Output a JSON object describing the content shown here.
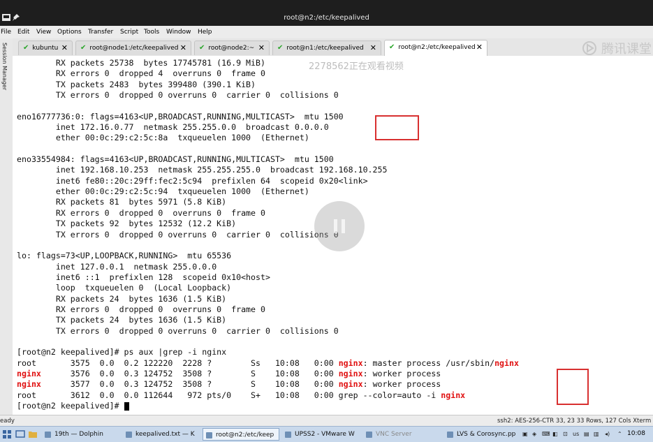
{
  "window": {
    "title": "root@n2:/etc/keepalived"
  },
  "menu": [
    "File",
    "Edit",
    "View",
    "Options",
    "Transfer",
    "Script",
    "Tools",
    "Window",
    "Help"
  ],
  "sidebar": {
    "label": "Session Manager"
  },
  "tabs": [
    {
      "label": "kubuntu",
      "active": false
    },
    {
      "label": "root@node1:/etc/keepalived",
      "active": false
    },
    {
      "label": "root@node2:~",
      "active": false
    },
    {
      "label": "root@n1:/etc/keepalived",
      "active": false
    },
    {
      "label": "root@n2:/etc/keepalived",
      "active": true
    }
  ],
  "brand": "腾讯课堂",
  "watermark": "2278562正在观看视频",
  "terminal": {
    "lines": [
      [
        {
          "t": "        RX packets 25738  bytes 17745781 (16.9 MiB)"
        }
      ],
      [
        {
          "t": "        RX errors 0  dropped 4  overruns 0  frame 0"
        }
      ],
      [
        {
          "t": "        TX packets 2483  bytes 399480 (390.1 KiB)"
        }
      ],
      [
        {
          "t": "        TX errors 0  dropped 0 overruns 0  carrier 0  collisions 0"
        }
      ],
      [
        {
          "t": ""
        }
      ],
      [
        {
          "t": "eno16777736:0: flags=4163<UP,BROADCAST,RUNNING,MULTICAST>  mtu 1500"
        }
      ],
      [
        {
          "t": "        inet 172.16.0.77  netmask 255.255.0.0  broadcast 0.0.0.0"
        }
      ],
      [
        {
          "t": "        ether 00:0c:29:c2:5c:8a  txqueuelen 1000  (Ethernet)"
        }
      ],
      [
        {
          "t": ""
        }
      ],
      [
        {
          "t": "eno33554984: flags=4163<UP,BROADCAST,RUNNING,MULTICAST>  mtu 1500"
        }
      ],
      [
        {
          "t": "        inet 192.168.10.253  netmask 255.255.255.0  broadcast 192.168.10.255"
        }
      ],
      [
        {
          "t": "        inet6 fe80::20c:29ff:fec2:5c94  prefixlen 64  scopeid 0x20<link>"
        }
      ],
      [
        {
          "t": "        ether 00:0c:29:c2:5c:94  txqueuelen 1000  (Ethernet)"
        }
      ],
      [
        {
          "t": "        RX packets 81  bytes 5971 (5.8 KiB)"
        }
      ],
      [
        {
          "t": "        RX errors 0  dropped 0  overruns 0  frame 0"
        }
      ],
      [
        {
          "t": "        TX packets 92  bytes 12532 (12.2 KiB)"
        }
      ],
      [
        {
          "t": "        TX errors 0  dropped 0 overruns 0  carrier 0  collisions 0"
        }
      ],
      [
        {
          "t": ""
        }
      ],
      [
        {
          "t": "lo: flags=73<UP,LOOPBACK,RUNNING>  mtu 65536"
        }
      ],
      [
        {
          "t": "        inet 127.0.0.1  netmask 255.0.0.0"
        }
      ],
      [
        {
          "t": "        inet6 ::1  prefixlen 128  scopeid 0x10<host>"
        }
      ],
      [
        {
          "t": "        loop  txqueuelen 0  (Local Loopback)"
        }
      ],
      [
        {
          "t": "        RX packets 24  bytes 1636 (1.5 KiB)"
        }
      ],
      [
        {
          "t": "        RX errors 0  dropped 0  overruns 0  frame 0"
        }
      ],
      [
        {
          "t": "        TX packets 24  bytes 1636 (1.5 KiB)"
        }
      ],
      [
        {
          "t": "        TX errors 0  dropped 0 overruns 0  carrier 0  collisions 0"
        }
      ],
      [
        {
          "t": ""
        }
      ],
      [
        {
          "t": "[root@n2 keepalived]# ps aux |grep -i nginx"
        }
      ],
      [
        {
          "t": "root       3575  0.0  0.2 122220  2228 ?        Ss   10:08   0:00 "
        },
        {
          "t": "nginx",
          "hl": true
        },
        {
          "t": ": master process /usr/sbin/"
        },
        {
          "t": "nginx",
          "hl": true
        }
      ],
      [
        {
          "t": "nginx",
          "hl": true
        },
        {
          "t": "      3576  0.0  0.3 124752  3508 ?        S    10:08   0:00 "
        },
        {
          "t": "nginx",
          "hl": true
        },
        {
          "t": ": worker process"
        }
      ],
      [
        {
          "t": "nginx",
          "hl": true
        },
        {
          "t": "      3577  0.0  0.3 124752  3508 ?        S    10:08   0:00 "
        },
        {
          "t": "nginx",
          "hl": true
        },
        {
          "t": ": worker process"
        }
      ],
      [
        {
          "t": "root       3612  0.0  0.0 112644   972 pts/0    S+   10:08   0:00 grep --color=auto -i "
        },
        {
          "t": "nginx",
          "hl": true
        }
      ],
      [
        {
          "t": "[root@n2 keepalived]# "
        }
      ]
    ]
  },
  "status": {
    "left": "eady",
    "right": "ssh2: AES-256-CTR     33, 23  33 Rows, 127 Cols  Xterm"
  },
  "taskbar": {
    "buttons": [
      {
        "label": "19th — Dolphin",
        "active": false,
        "faint": false
      },
      {
        "label": "keepalived.txt — K",
        "active": false,
        "faint": false
      },
      {
        "label": "root@n2:/etc/keep",
        "active": true,
        "faint": false
      },
      {
        "label": "UPSS2 - VMware W",
        "active": false,
        "faint": false
      },
      {
        "label": "VNC Server",
        "active": false,
        "faint": true
      },
      {
        "label": "LVS & Corosync.pp",
        "active": false,
        "faint": false
      }
    ],
    "tray": "us",
    "time": "10:08"
  },
  "colors": {
    "highlight": "#e01010",
    "annotation_box": "#d83030"
  }
}
